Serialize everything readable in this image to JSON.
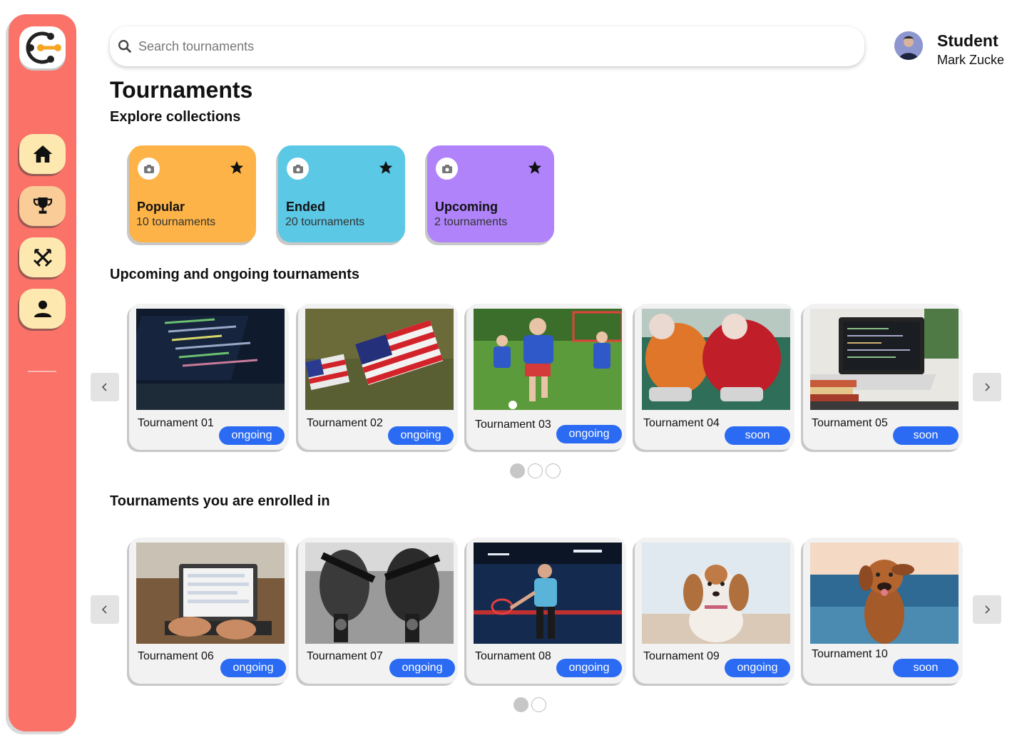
{
  "search": {
    "placeholder": "Search tournaments",
    "icon": "search-icon"
  },
  "user": {
    "role": "Student",
    "name": "Mark Zucke"
  },
  "page_title": "Tournaments",
  "sections": {
    "collections": "Explore collections",
    "upcoming": "Upcoming and ongoing tournaments",
    "enrolled": "Tournaments you are enrolled in"
  },
  "sidebar": {
    "items": [
      {
        "icon": "home-icon"
      },
      {
        "icon": "trophy-icon"
      },
      {
        "icon": "crossed-swords-icon"
      },
      {
        "icon": "user-icon"
      }
    ]
  },
  "colors": {
    "sidebar": "#fa7268",
    "popular": "#fdb347",
    "ended": "#5bc8e6",
    "upcoming": "#b083fa",
    "badge": "#2b6bf3"
  },
  "collections": [
    {
      "name": "Popular",
      "count": "10 tournaments"
    },
    {
      "name": "Ended",
      "count": "20 tournaments"
    },
    {
      "name": "Upcoming",
      "count": "2 tournaments"
    }
  ],
  "upcoming_tournaments": [
    {
      "name": "Tournament 01",
      "status": "ongoing"
    },
    {
      "name": "Tournament 02",
      "status": "ongoing"
    },
    {
      "name": "Tournament 03",
      "status": "ongoing"
    },
    {
      "name": "Tournament 04",
      "status": "soon"
    },
    {
      "name": "Tournament 05",
      "status": "soon"
    }
  ],
  "enrolled_tournaments": [
    {
      "name": "Tournament 06",
      "status": "ongoing"
    },
    {
      "name": "Tournament 07",
      "status": "ongoing"
    },
    {
      "name": "Tournament 08",
      "status": "ongoing"
    },
    {
      "name": "Tournament 09",
      "status": "ongoing"
    },
    {
      "name": "Tournament 10",
      "status": "soon"
    }
  ]
}
